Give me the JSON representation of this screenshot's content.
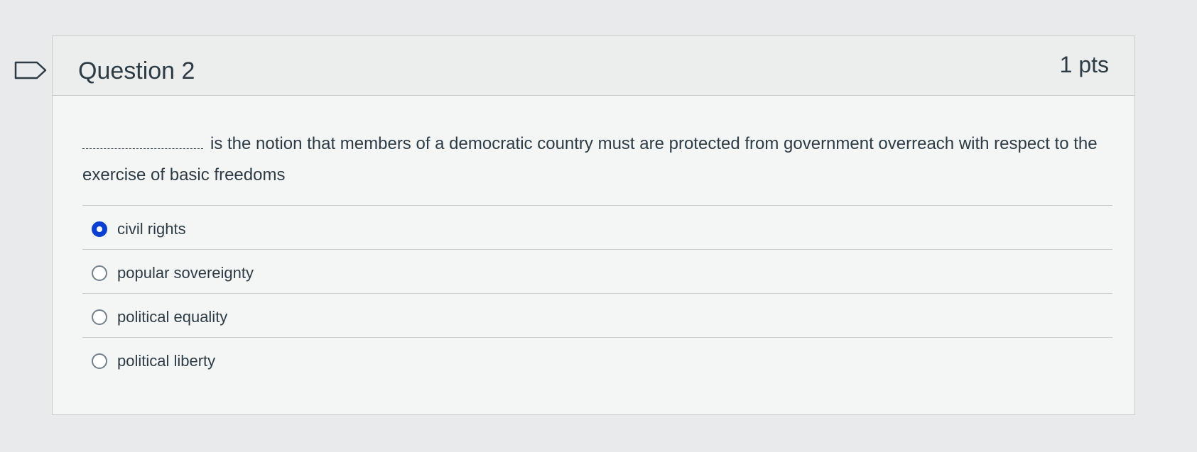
{
  "question": {
    "title": "Question 2",
    "points": "1 pts",
    "blank": "____________",
    "text": "is the notion that members of a democratic country must are protected from government overreach with respect to the exercise of basic freedoms"
  },
  "answers": [
    {
      "label": "civil rights",
      "selected": true
    },
    {
      "label": "popular sovereignty",
      "selected": false
    },
    {
      "label": "political equality",
      "selected": false
    },
    {
      "label": "political liberty",
      "selected": false
    }
  ],
  "icons": {
    "flag": "flag-outline-icon"
  },
  "colors": {
    "selected_radio": "#0b3fd1",
    "text": "#2d3b45"
  }
}
